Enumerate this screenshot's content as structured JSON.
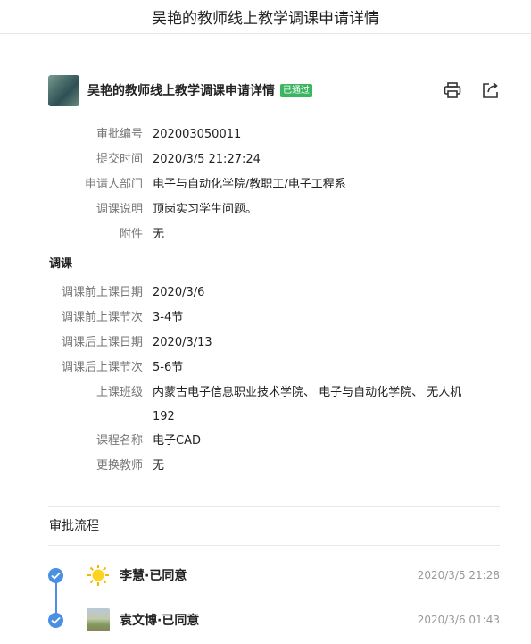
{
  "topbar": {
    "title": "吴艳的教师线上教学调课申请详情"
  },
  "header": {
    "title": "吴艳的教师线上教学调课申请详情",
    "status": "已通过"
  },
  "fields": [
    {
      "label": "审批编号",
      "value": "202003050011"
    },
    {
      "label": "提交时间",
      "value": "2020/3/5 21:27:24"
    },
    {
      "label": "申请人部门",
      "value": "电子与自动化学院/教职工/电子工程系"
    },
    {
      "label": "调课说明",
      "value": "顶岗实习学生问题。"
    },
    {
      "label": "附件",
      "value": "无"
    }
  ],
  "section": {
    "title": "调课",
    "fields": [
      {
        "label": "调课前上课日期",
        "value": "2020/3/6"
      },
      {
        "label": "调课前上课节次",
        "value": "3-4节"
      },
      {
        "label": "调课后上课日期",
        "value": "2020/3/13"
      },
      {
        "label": "调课后上课节次",
        "value": "5-6节"
      },
      {
        "label": "上课班级",
        "value": "内蒙古电子信息职业技术学院、 电子与自动化学院、 无人机",
        "value2": "192"
      },
      {
        "label": "课程名称",
        "value": "电子CAD"
      },
      {
        "label": "更换教师",
        "value": "无"
      }
    ]
  },
  "flow": {
    "title": "审批流程",
    "steps": [
      {
        "name": "李慧·已同意",
        "time": "2020/3/5 21:28",
        "avatar": "sun-icon"
      },
      {
        "name": "袁文博·已同意",
        "time": "2020/3/6 01:43",
        "avatar": "landscape-photo"
      }
    ]
  },
  "colors": {
    "accent": "#4a90e2",
    "badge": "#3bb561"
  }
}
